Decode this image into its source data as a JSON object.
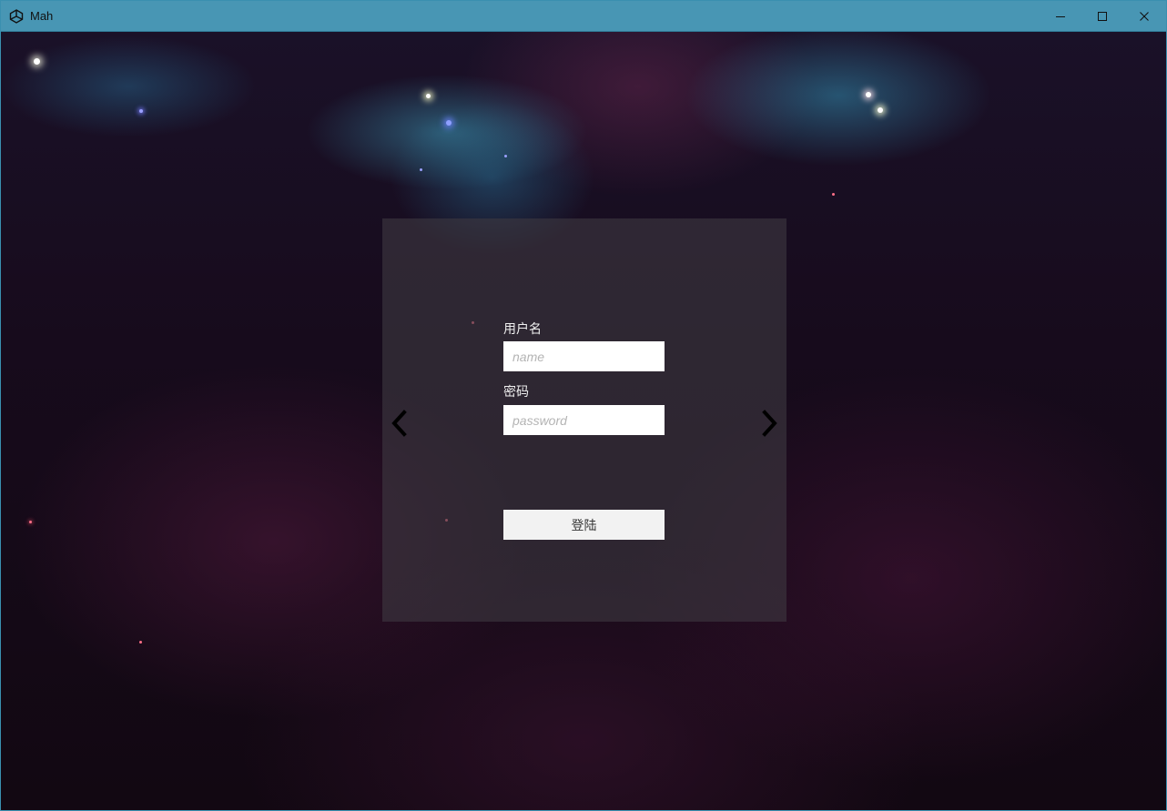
{
  "window": {
    "title": "Mah",
    "app_icon": "unity-icon",
    "controls": [
      "minimize-icon",
      "maximize-icon",
      "close-icon"
    ]
  },
  "login": {
    "username_label": "用户名",
    "username_placeholder": "name",
    "username_value": "",
    "password_label": "密码",
    "password_placeholder": "password",
    "password_value": "",
    "submit_label": "登陆",
    "prev_icon": "chevron-left-icon",
    "next_icon": "chevron-right-icon"
  },
  "colors": {
    "titlebar": "#4896b4",
    "panel": "#3e3840",
    "input_bg": "#ffffff",
    "button_bg": "#f2f2f2"
  }
}
